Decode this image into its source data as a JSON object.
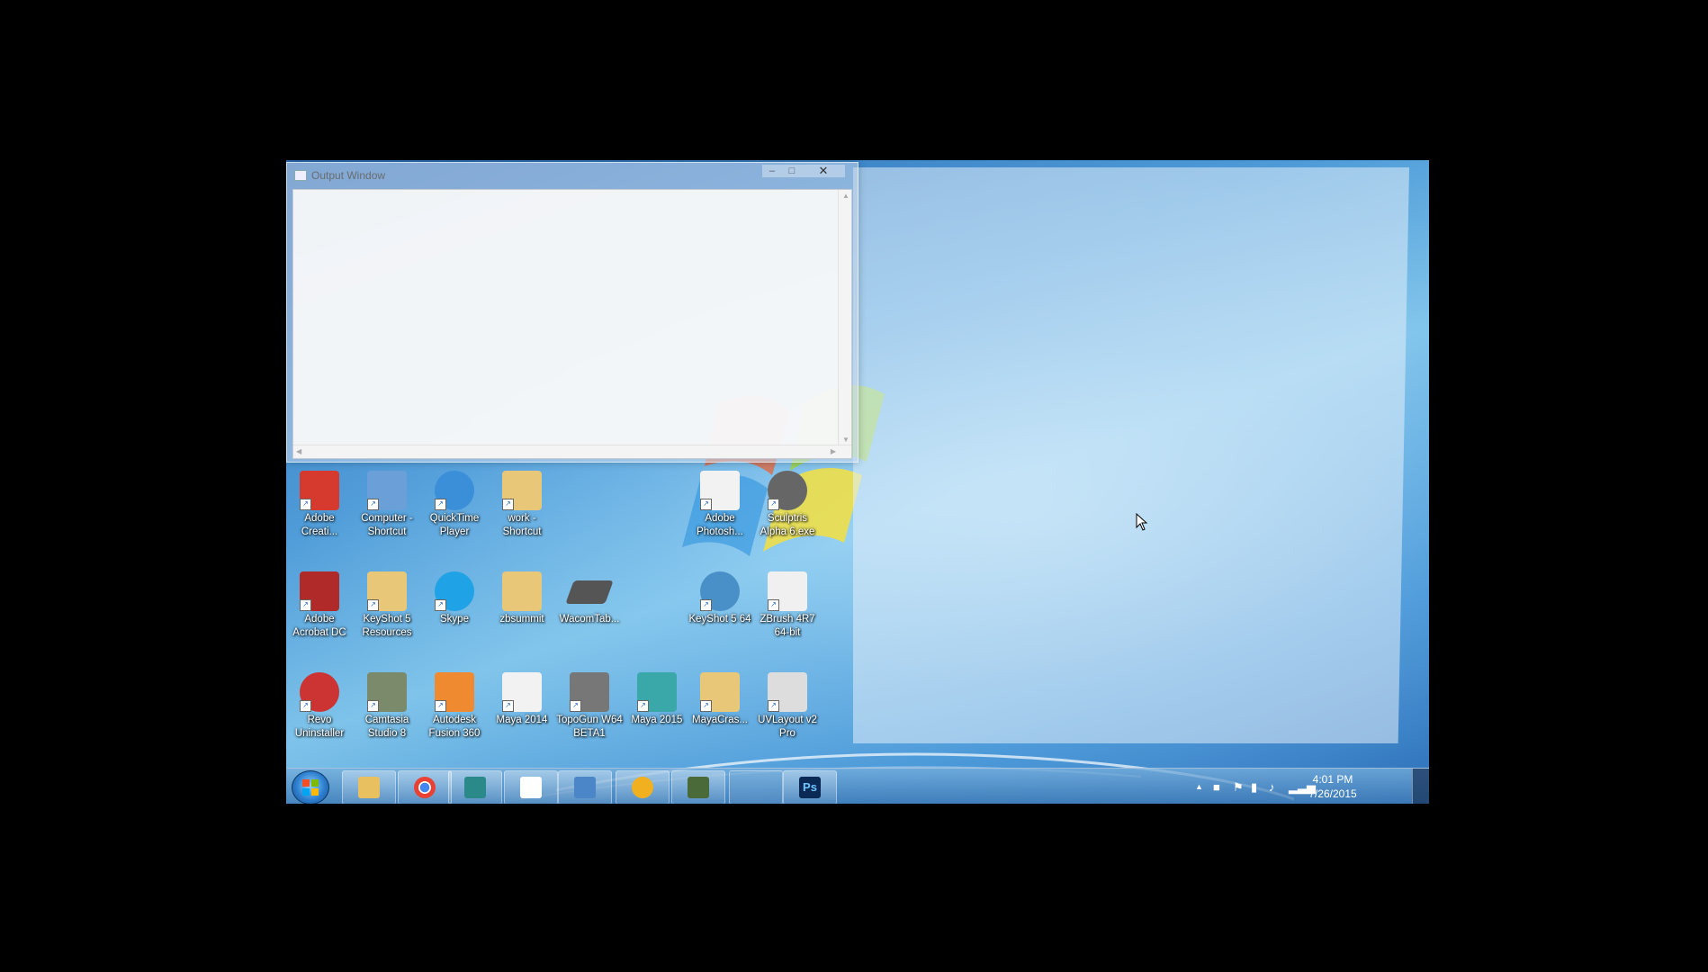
{
  "output_window": {
    "title": "Output Window",
    "icon": "window-icon",
    "min_glyph": "–",
    "max_glyph": "□",
    "close_glyph": "✕"
  },
  "desktop_icons": [
    {
      "label": "Adobe Creati...",
      "icon": "adobe-creative-cloud-icon",
      "color": "#d63a2f",
      "shortcut": true
    },
    {
      "label": "Computer - Shortcut",
      "icon": "computer-icon",
      "color": "#6b9fd8",
      "shortcut": true
    },
    {
      "label": "QuickTime Player",
      "icon": "quicktime-icon",
      "color": "#3a8fd8",
      "shortcut": true
    },
    {
      "label": "work - Shortcut",
      "icon": "folder-icon",
      "color": "#e8c878",
      "shortcut": true
    },
    {
      "label": "Adobe Photosh...",
      "icon": "document-icon",
      "color": "#f2f2f2",
      "shortcut": true
    },
    {
      "label": "Sculptris Alpha 6.exe",
      "icon": "sculptris-icon",
      "color": "#666666",
      "shortcut": true
    },
    {
      "label": "Adobe Acrobat DC",
      "icon": "acrobat-icon",
      "color": "#b02a2a",
      "shortcut": true
    },
    {
      "label": "KeyShot 5 Resources",
      "icon": "folder-icon",
      "color": "#e8c878",
      "shortcut": true
    },
    {
      "label": "Skype",
      "icon": "skype-icon",
      "color": "#1fa3e6",
      "shortcut": true
    },
    {
      "label": "zbsummit",
      "icon": "folder-icon",
      "color": "#e8c878",
      "shortcut": false
    },
    {
      "label": "WacomTab...",
      "icon": "wacom-tablet-icon",
      "color": "#555555",
      "shortcut": false
    },
    {
      "label": "KeyShot 5 64",
      "icon": "keyshot-icon",
      "color": "#4a90c8",
      "shortcut": true
    },
    {
      "label": "ZBrush 4R7 64-bit",
      "icon": "zbrush-icon",
      "color": "#f0f0f0",
      "shortcut": true
    },
    {
      "label": "Revo Uninstaller",
      "icon": "revo-uninstaller-icon",
      "color": "#cc3333",
      "shortcut": true
    },
    {
      "label": "Camtasia Studio 8",
      "icon": "camtasia-icon",
      "color": "#7a8a6a",
      "shortcut": true
    },
    {
      "label": "Autodesk Fusion 360",
      "icon": "fusion-360-icon",
      "color": "#f08a30",
      "shortcut": true
    },
    {
      "label": "Maya 2014",
      "icon": "document-icon",
      "color": "#f2f2f2",
      "shortcut": true
    },
    {
      "label": "TopoGun W64 BETA1",
      "icon": "topogun-icon",
      "color": "#777777",
      "shortcut": true
    },
    {
      "label": "Maya 2015",
      "icon": "maya-icon",
      "color": "#3aa8a8",
      "shortcut": true
    },
    {
      "label": "MayaCras...",
      "icon": "folder-icon",
      "color": "#e8c878",
      "shortcut": true
    },
    {
      "label": "UVLayout v2 Pro",
      "icon": "uvlayout-icon",
      "color": "#dddddd",
      "shortcut": true
    }
  ],
  "taskbar": {
    "buttons": [
      {
        "name": "file-explorer-icon",
        "color": "#e8c060"
      },
      {
        "name": "chrome-icon",
        "color": "#e94235"
      },
      {
        "name": "maya-icon",
        "color": "#2a8a8a"
      },
      {
        "name": "zbrush-icon",
        "color": "#ffffff"
      },
      {
        "name": "photo-viewer-icon",
        "color": "#4a86c8"
      },
      {
        "name": "flower-app-icon",
        "color": "#f0b020"
      },
      {
        "name": "camtasia-recorder-icon",
        "color": "#4a6a3a"
      },
      {
        "name": "blank-taskbar-slot",
        "color": "#6aa0d8"
      },
      {
        "name": "photoshop-icon",
        "color": "#0a2a55"
      }
    ],
    "photoshop_label": "Ps"
  },
  "tray": {
    "show_hidden_glyph": "▲",
    "time": "4:01 PM",
    "date": "7/26/2015"
  }
}
